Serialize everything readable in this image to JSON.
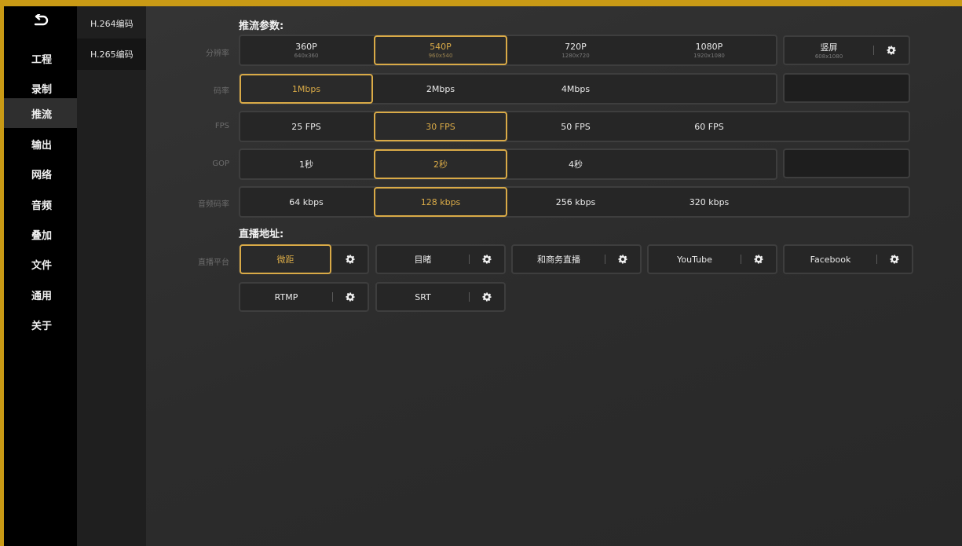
{
  "nav": {
    "back_icon": "back-arrow-icon",
    "items": [
      "工程",
      "录制",
      "推流",
      "输出",
      "网络",
      "音频",
      "叠加",
      "文件",
      "通用",
      "关于"
    ],
    "active": "推流"
  },
  "subnav": {
    "items": [
      "H.264编码",
      "H.265编码"
    ],
    "active": "H.264编码"
  },
  "params": {
    "title": "推流参数:",
    "resolution": {
      "label": "分辨率",
      "options": [
        {
          "label": "360P",
          "sub": "640x360"
        },
        {
          "label": "540P",
          "sub": "960x540"
        },
        {
          "label": "720P",
          "sub": "1280x720"
        },
        {
          "label": "1080P",
          "sub": "1920x1080"
        }
      ],
      "selected": "540P",
      "portrait": {
        "label": "竖屏",
        "sub": "608x1080"
      }
    },
    "bitrate": {
      "label": "码率",
      "options": [
        "1Mbps",
        "2Mbps",
        "4Mbps"
      ],
      "selected": "1Mbps"
    },
    "fps": {
      "label": "FPS",
      "options": [
        "25 FPS",
        "30 FPS",
        "50 FPS",
        "60 FPS"
      ],
      "selected": "30 FPS"
    },
    "gop": {
      "label": "GOP",
      "options": [
        "1秒",
        "2秒",
        "4秒"
      ],
      "selected": "2秒"
    },
    "audio_bitrate": {
      "label": "音频码率",
      "options": [
        "64 kbps",
        "128 kbps",
        "256 kbps",
        "320 kbps"
      ],
      "selected": "128 kbps"
    }
  },
  "live": {
    "title": "直播地址:",
    "label": "直播平台",
    "platforms": [
      "微距",
      "目睹",
      "和商务直播",
      "YouTube",
      "Facebook",
      "RTMP",
      "SRT"
    ],
    "selected": "微距"
  },
  "colors": {
    "accent": "#d9aa47",
    "frame": "#c99a15",
    "background": "#2e2e2e",
    "sidebar": "#000000"
  }
}
